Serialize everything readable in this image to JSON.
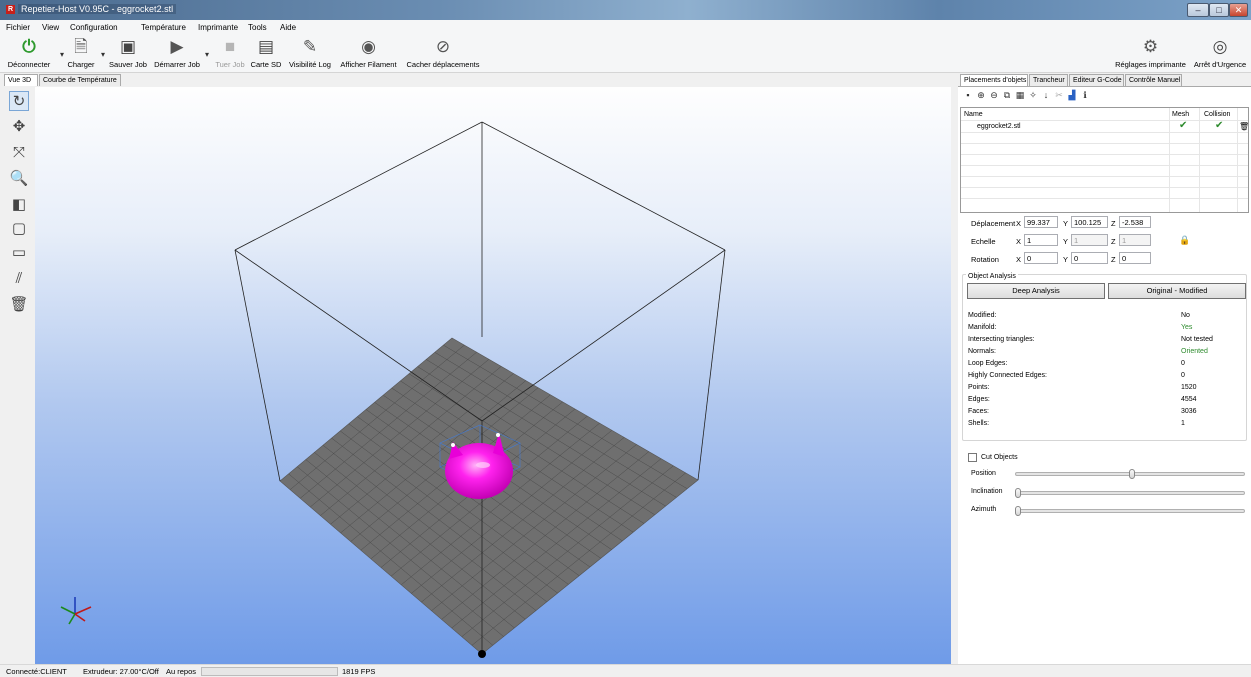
{
  "window": {
    "title": "Repetier-Host V0.95C - eggrocket2.stl"
  },
  "menu": [
    "Fichier",
    "View",
    "Configuration",
    "Température",
    "Imprimante",
    "Tools",
    "Aide"
  ],
  "toolbar": {
    "disconnect": "Déconnecter",
    "load": "Charger",
    "save_job": "Sauver Job",
    "start_job": "Démarrer Job",
    "kill_job": "Tuer Job",
    "sd_card": "Carte SD",
    "log_visibility": "Visibilité Log",
    "show_filament": "Afficher Filament",
    "hide_moves": "Cacher déplacements",
    "printer_settings": "Réglages imprimante",
    "emergency_stop": "Arrêt d'Urgence"
  },
  "left_tabs": [
    "Vue 3D",
    "Courbe de Température"
  ],
  "right_tabs": [
    "Placements d'objets",
    "Trancheur",
    "Editeur G-Code",
    "Contrôle Manuel"
  ],
  "object_list": {
    "headers": {
      "name": "Name",
      "mesh": "Mesh",
      "collision": "Collision"
    },
    "rows": [
      {
        "name": "eggrocket2.stl",
        "mesh": true,
        "collision": true
      }
    ]
  },
  "transform": {
    "translation_label": "Déplacement",
    "scale_label": "Echelle",
    "rotation_label": "Rotation",
    "x": "X",
    "y": "Y",
    "z": "Z",
    "translation": {
      "x": "99.337",
      "y": "100.125",
      "z": "-2.538"
    },
    "scale": {
      "x": "1",
      "y": "1",
      "z": "1"
    },
    "rotation": {
      "x": "0",
      "y": "0",
      "z": "0"
    }
  },
  "analysis": {
    "title": "Object Analysis",
    "deep_button": "Deep Analysis",
    "orig_button": "Original - Modified",
    "rows": [
      {
        "label": "Modified:",
        "value": "No"
      },
      {
        "label": "Manifold:",
        "value": "Yes"
      },
      {
        "label": "Intersecting triangles:",
        "value": "Not tested"
      },
      {
        "label": "Normals:",
        "value": "Oriented"
      },
      {
        "label": "Loop Edges:",
        "value": "0"
      },
      {
        "label": "Highly Connected Edges:",
        "value": "0"
      },
      {
        "label": "Points:",
        "value": "1520"
      },
      {
        "label": "Edges:",
        "value": "4554"
      },
      {
        "label": "Faces:",
        "value": "3036"
      },
      {
        "label": "Shells:",
        "value": "1"
      }
    ]
  },
  "cut": {
    "label": "Cut Objects",
    "position": "Position",
    "inclination": "Inclination",
    "azimuth": "Azimuth",
    "position_level": 0.51,
    "inclination_level": 0.0,
    "azimuth_level": 0.0
  },
  "status": {
    "connection": "Connecté:CLIENT",
    "extruder": "Extrudeur: 27.00°C/Off",
    "state": "Au repos",
    "fps": "1819 FPS"
  },
  "colors": {
    "object": "#ff22ee",
    "bed": "#6f6f6f",
    "green_ok": "#2e8b2e"
  }
}
